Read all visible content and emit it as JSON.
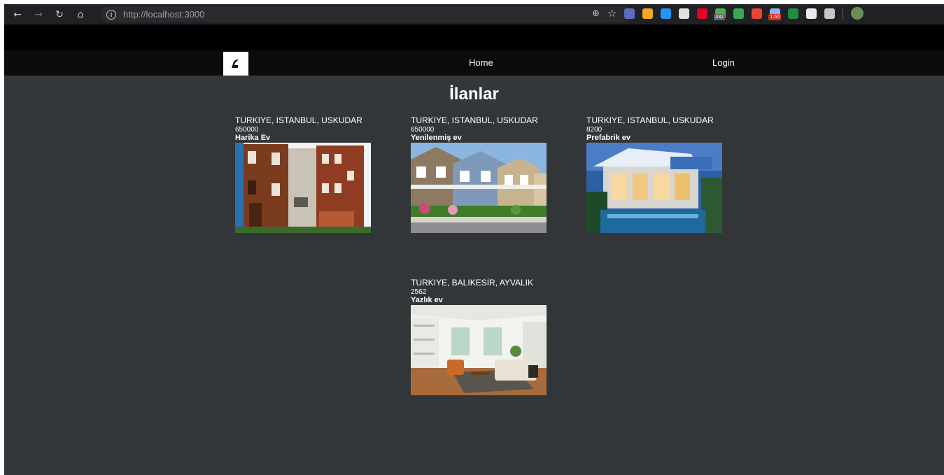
{
  "browser": {
    "url": "http://localhost:3000",
    "extensions": [
      {
        "name": "ia-extension-icon",
        "color": "#5c6bc0"
      },
      {
        "name": "orange-extension-icon",
        "color": "#f5a623"
      },
      {
        "name": "blue-extension-icon",
        "color": "#2196f3"
      },
      {
        "name": "speedometer-extension-icon",
        "color": "#e0e0e0"
      },
      {
        "name": "pinterest-icon",
        "color": "#e60023"
      },
      {
        "name": "counter-extension-icon",
        "color": "#4caf50",
        "badge": "432"
      },
      {
        "name": "shield-extension-icon",
        "color": "#34a853"
      },
      {
        "name": "glasses-extension-icon",
        "color": "#ea4335"
      },
      {
        "name": "timer-extension-icon",
        "color": "#8ab4f8",
        "badge": "1.50"
      },
      {
        "name": "download-extension-icon",
        "color": "#1e8e3e"
      },
      {
        "name": "page-extension-icon",
        "color": "#e8eaed"
      },
      {
        "name": "puzzle-icon",
        "color": "#c7c7c7"
      }
    ]
  },
  "header": {
    "home_label": "Home",
    "login_label": "Login"
  },
  "page": {
    "title": "İlanlar"
  },
  "listings": [
    {
      "location": "TURKIYE, ISTANBUL, USKUDAR",
      "price": "650000",
      "title": "Harika Ev",
      "image": "wooden-houses-photo"
    },
    {
      "location": "TURKIYE, ISTANBUL, USKUDAR",
      "price": "650000",
      "title": "Yenilenmiş ev",
      "image": "suburban-houses-photo"
    },
    {
      "location": "TURKIYE, ISTANBUL, USKUDAR",
      "price": "8200",
      "title": "Prefabrik ev",
      "image": "modern-villa-photo"
    },
    {
      "location": "TURKIYE, BALIKESİR, AYVALIK",
      "price": "2562",
      "title": "Yazlık ev",
      "image": "living-room-photo"
    }
  ]
}
